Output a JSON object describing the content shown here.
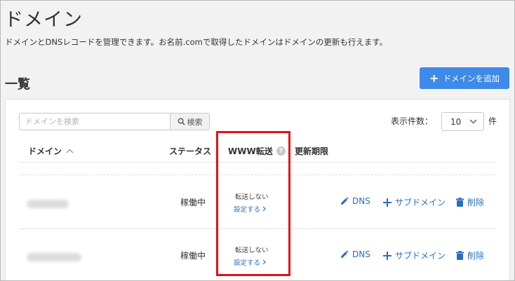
{
  "page": {
    "title": "ドメイン",
    "description": "ドメインとDNSレコードを管理できます。お名前.comで取得したドメインはドメインの更新も行えます。"
  },
  "list": {
    "section_title": "一覧",
    "add_button_label": "ドメインを追加",
    "search": {
      "placeholder": "ドメインを検索",
      "button_label": "検索"
    },
    "per_page": {
      "label": "表示件数：",
      "value": "10",
      "unit": "件"
    },
    "columns": {
      "domain": "ドメイン",
      "status": "ステータス",
      "www": "WWW転送",
      "expire": "更新期限"
    },
    "rows": [
      {
        "status": "稼働中",
        "www_state": "転送しない",
        "www_link": "設定する",
        "actions": {
          "dns": "DNS",
          "subdomain": "サブドメイン",
          "delete": "削除"
        }
      },
      {
        "status": "稼働中",
        "www_state": "転送しない",
        "www_link": "設定する",
        "actions": {
          "dns": "DNS",
          "subdomain": "サブドメイン",
          "delete": "削除"
        }
      }
    ]
  },
  "colors": {
    "accent": "#3d8ae8",
    "link": "#2a6cc4",
    "highlight": "#e3101b"
  },
  "icons": [
    "plus-icon",
    "search-icon",
    "chevron-down-icon",
    "sort-up-icon",
    "help-icon",
    "pencil-icon",
    "trash-icon",
    "chevron-right-icon"
  ]
}
